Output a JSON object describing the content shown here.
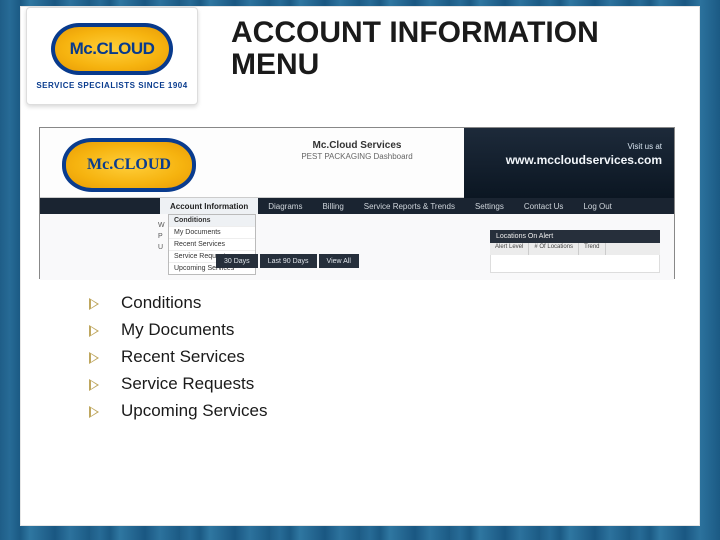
{
  "brand": {
    "logo_text": "Mc.CLOUD",
    "tagline": "SERVICE SPECIALISTS SINCE 1904"
  },
  "slide": {
    "title": "ACCOUNT INFORMATION MENU"
  },
  "dashboard": {
    "logo_text": "Mc.CLOUD",
    "logo_tagline": "SERVICE SPECIALISTS SINCE 1904",
    "brand_line": "Mc.Cloud Services",
    "brand_sub": "PEST PACKAGING Dashboard",
    "visit_label": "Visit us at",
    "visit_url": "www.mccloudservices.com",
    "nav": {
      "items": [
        "Account Information",
        "Diagrams",
        "Billing",
        "Service Reports & Trends",
        "Settings",
        "Contact Us",
        "Log Out"
      ],
      "active_index": 0
    },
    "dropdown": {
      "items": [
        "Conditions",
        "My Documents",
        "Recent Services",
        "Service Requests",
        "Upcoming Services"
      ]
    },
    "side_letters": [
      "W",
      "P",
      "U"
    ],
    "range_pills": [
      "30 Days",
      "Last 90 Days",
      "View All"
    ],
    "alerts": {
      "title": "Locations On Alert",
      "columns": [
        "Alert Level",
        "# Of Locations",
        "Trend"
      ]
    }
  },
  "bullets": [
    "Conditions",
    "My Documents",
    "Recent Services",
    "Service Requests",
    "Upcoming Services"
  ]
}
